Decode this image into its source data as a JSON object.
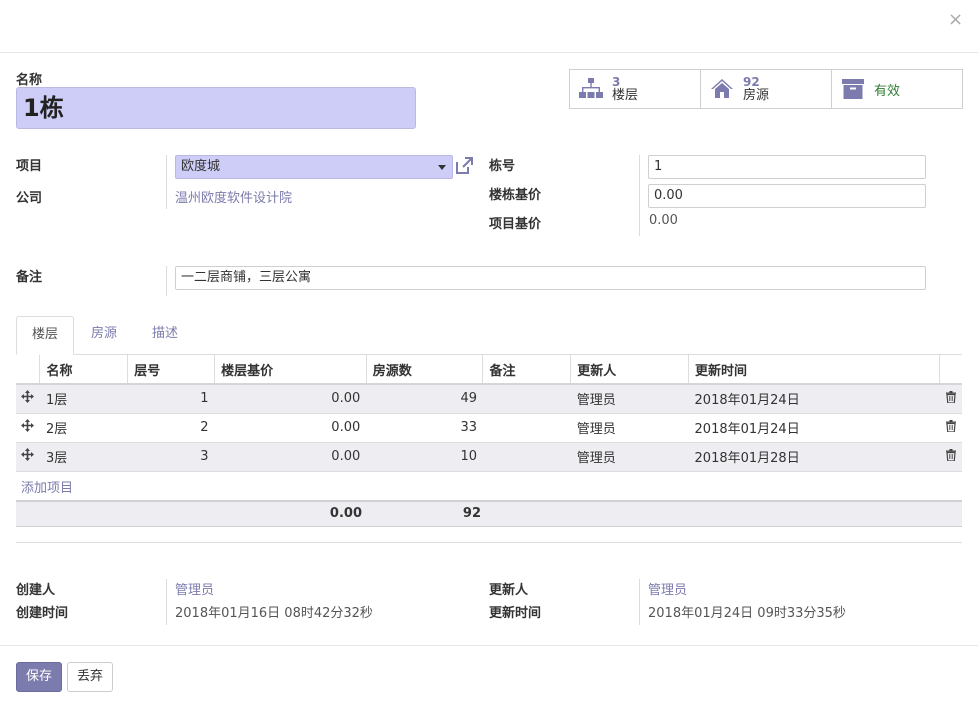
{
  "dialog": {
    "close_symbol": "×"
  },
  "header": {
    "name_label": "名称",
    "name_value": "1栋"
  },
  "stats": [
    {
      "icon": "sitemap-icon",
      "count": "3",
      "label": "楼层"
    },
    {
      "icon": "home-icon",
      "count": "92",
      "label": "房源"
    },
    {
      "icon": "archive-icon",
      "label": "有效"
    }
  ],
  "fields": {
    "project_label": "项目",
    "project_value": "欧度城",
    "company_label": "公司",
    "company_value": "温州欧度软件设计院",
    "building_no_label": "栋号",
    "building_no_value": "1",
    "building_price_label": "楼栋基价",
    "building_price_value": "0.00",
    "project_price_label": "项目基价",
    "project_price_value": "0.00",
    "remark_label": "备注",
    "remark_value": "一二层商铺，三层公寓"
  },
  "tabs": [
    "楼层",
    "房源",
    "描述"
  ],
  "table": {
    "columns": [
      "名称",
      "层号",
      "楼层基价",
      "房源数",
      "备注",
      "更新人",
      "更新时间"
    ],
    "rows": [
      {
        "name": "1层",
        "floor": "1",
        "price": "0.00",
        "rooms": "49",
        "remark": "",
        "updater": "管理员",
        "updated": "2018年01月24日"
      },
      {
        "name": "2层",
        "floor": "2",
        "price": "0.00",
        "rooms": "33",
        "remark": "",
        "updater": "管理员",
        "updated": "2018年01月24日"
      },
      {
        "name": "3层",
        "floor": "3",
        "price": "0.00",
        "rooms": "10",
        "remark": "",
        "updater": "管理员",
        "updated": "2018年01月28日"
      }
    ],
    "add_line": "添加项目",
    "totals": {
      "price": "0.00",
      "rooms": "92"
    }
  },
  "meta": {
    "creator_label": "创建人",
    "creator_value": "管理员",
    "created_label": "创建时间",
    "created_value": "2018年01月16日 08时42分32秒",
    "updater_label": "更新人",
    "updater_value": "管理员",
    "updated_label": "更新时间",
    "updated_value": "2018年01月24日 09时33分35秒"
  },
  "buttons": {
    "save": "保存",
    "discard": "丢弃"
  },
  "colors": {
    "primary": "#7c7bad",
    "highlight": "#cdcdf7",
    "active": "#2e7d32"
  }
}
